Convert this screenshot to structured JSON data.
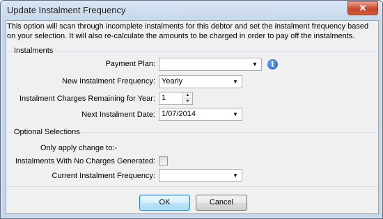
{
  "window": {
    "title": "Update Instalment Frequency",
    "close_glyph": "✕"
  },
  "description": "This option will scan through incomplete instalments for this debtor and set the instalment frequency based on your selection.  It will also re-calculate the amounts to be charged in order to pay off the instalments.",
  "instalments": {
    "group_label": "Instalments",
    "payment_plan": {
      "label": "Payment Plan:",
      "value": ""
    },
    "info_icon": "i",
    "new_frequency": {
      "label": "New Instalment Frequency:",
      "value": "Yearly"
    },
    "charges_remaining": {
      "label": "Instalment Charges Remaining for Year:",
      "value": "1"
    },
    "next_date": {
      "label": "Next Instalment Date:",
      "value": "1/07/2014"
    }
  },
  "optional": {
    "group_label": "Optional Selections",
    "only_apply": "Only apply change to:-",
    "no_charges": {
      "label": "Instalments With No Charges Generated:",
      "checked": false
    },
    "current_frequency": {
      "label": "Current Instalment Frequency:",
      "value": ""
    }
  },
  "buttons": {
    "ok": "OK",
    "cancel": "Cancel"
  }
}
